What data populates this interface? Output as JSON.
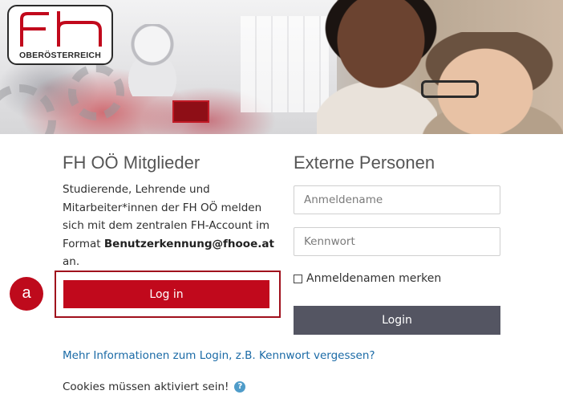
{
  "logo": {
    "letters": "fh",
    "name": "OBERÖSTERREICH"
  },
  "members": {
    "heading": "FH OÖ Mitglieder",
    "info_text": "Studierende, Lehrende und Mitarbeiter*innen der FH OÖ melden sich mit dem zentralen FH-Account im Format ",
    "info_format": "Benutzerkennung@fhooe.at",
    "info_end": "an.",
    "login_button": "Log in",
    "annotation_badge": "a"
  },
  "external": {
    "heading": "Externe Personen",
    "username_placeholder": "Anmeldename",
    "password_placeholder": "Kennwort",
    "remember_label": "Anmeldenamen merken",
    "remember_checked": false,
    "login_button": "Login"
  },
  "footer": {
    "more_info_link": "Mehr Informationen zum Login, z.B. Kennwort vergessen?",
    "cookies_text": "Cookies müssen aktiviert sein!",
    "help_icon": "question-circle-icon"
  },
  "colors": {
    "brand_red": "#c1091c",
    "login_gray": "#545562",
    "link_blue": "#1a6aa6"
  }
}
